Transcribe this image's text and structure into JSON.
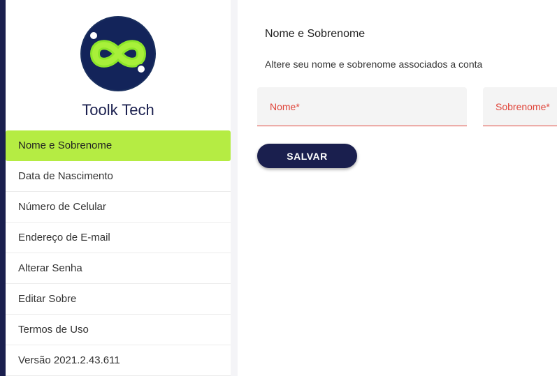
{
  "brand": {
    "name": "Toolk Tech",
    "logo_icon": "infinity-logo-icon",
    "colors": {
      "navy": "#1a1f4e",
      "lime": "#b5ec43",
      "error": "#e0453a"
    }
  },
  "sidebar": {
    "items": [
      {
        "label": "Nome e Sobrenome",
        "active": true
      },
      {
        "label": "Data de Nascimento"
      },
      {
        "label": "Número de Celular"
      },
      {
        "label": "Endereço de E-mail"
      },
      {
        "label": "Alterar Senha"
      },
      {
        "label": "Editar Sobre"
      },
      {
        "label": "Termos de Uso"
      },
      {
        "label": "Versão 2021.2.43.611"
      }
    ]
  },
  "main": {
    "title": "Nome e Sobrenome",
    "subtitle": "Altere seu nome e sobrenome associados a conta",
    "fields": {
      "nome": {
        "placeholder": "Nome*",
        "value": ""
      },
      "sobrenome": {
        "placeholder": "Sobrenome*",
        "value": ""
      }
    },
    "save_label": "SALVAR"
  }
}
